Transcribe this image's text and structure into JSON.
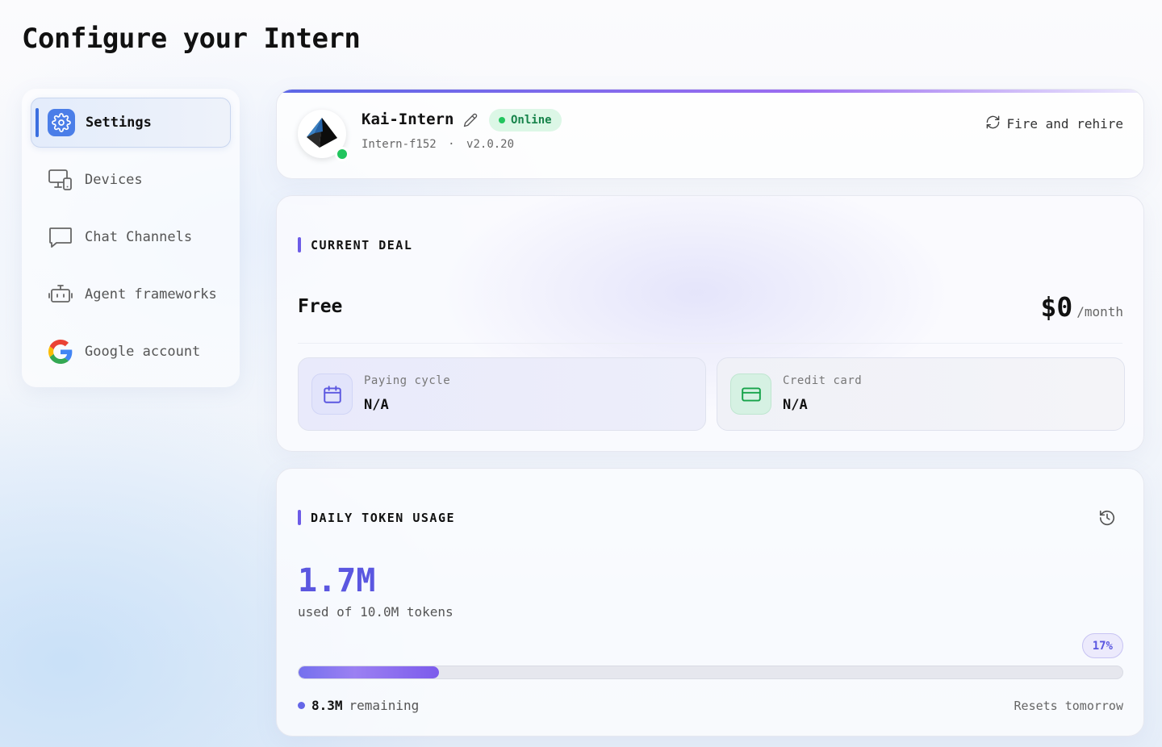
{
  "page": {
    "title": "Configure your Intern"
  },
  "sidebar": {
    "items": [
      {
        "label": "Settings",
        "icon": "gear-icon",
        "active": true
      },
      {
        "label": "Devices",
        "icon": "devices-icon",
        "active": false
      },
      {
        "label": "Chat Channels",
        "icon": "chat-icon",
        "active": false
      },
      {
        "label": "Agent frameworks",
        "icon": "robot-icon",
        "active": false
      },
      {
        "label": "Google account",
        "icon": "google-icon",
        "active": false
      }
    ]
  },
  "agent": {
    "name": "Kai-Intern",
    "status": "Online",
    "id": "Intern-f152",
    "separator": "·",
    "version": "v2.0.20",
    "action_label": "Fire and rehire"
  },
  "deal": {
    "section_label": "CURRENT DEAL",
    "plan": "Free",
    "price": "$0",
    "period": "/month",
    "paying_cycle_label": "Paying cycle",
    "paying_cycle_value": "N/A",
    "credit_card_label": "Credit card",
    "credit_card_value": "N/A"
  },
  "usage": {
    "section_label": "DAILY TOKEN USAGE",
    "used": "1.7M",
    "used_text": "used of 10.0M tokens",
    "percent_label": "17%",
    "percent": 0.17,
    "remaining_value": "8.3M",
    "remaining_text": "remaining",
    "resets_text": "Resets tomorrow"
  },
  "colors": {
    "accent": "#5b57e0",
    "online": "#22c55e",
    "active_nav": "#3b6fe0"
  }
}
